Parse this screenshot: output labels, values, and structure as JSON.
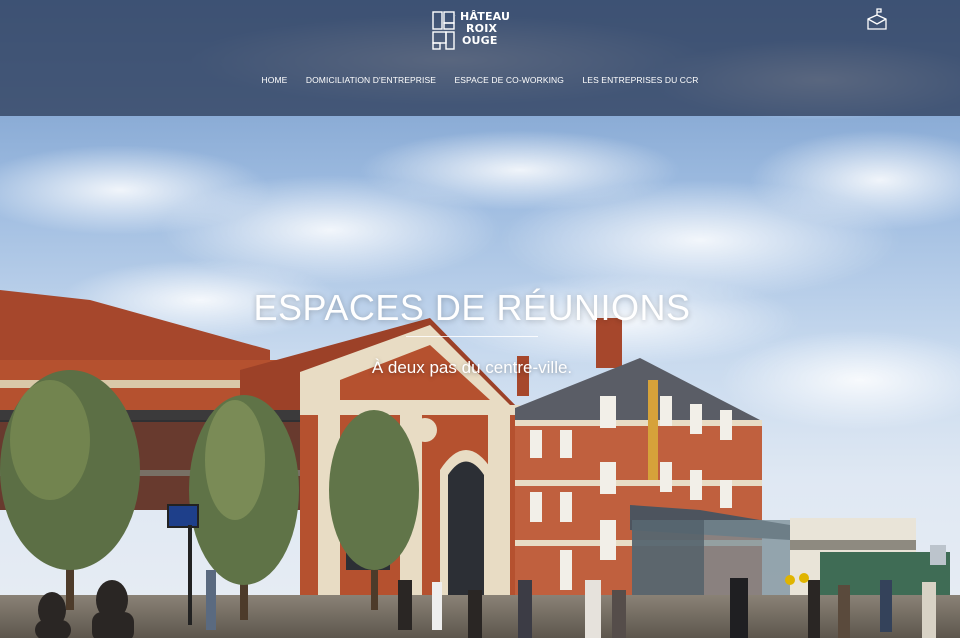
{
  "brand": {
    "logo_lines": [
      "HÂTEAU",
      "ROIX",
      "OUGE"
    ]
  },
  "nav": {
    "items": [
      {
        "label": "HOME"
      },
      {
        "label": "DOMICILIATION D'ENTREPRISE"
      },
      {
        "label": "ESPACE DE CO-WORKING"
      },
      {
        "label": "LES ENTREPRISES DU CCR"
      }
    ]
  },
  "header": {
    "mail_icon": "mailbox-icon"
  },
  "hero": {
    "title": "ESPACES DE RÉUNIONS",
    "subtitle": "À deux pas du centre-ville."
  },
  "colors": {
    "header_bg": "#2f3f5c",
    "brick": "#b5512f",
    "roof": "#a6472c",
    "stone": "#e8dcc4",
    "text": "#ffffff"
  }
}
